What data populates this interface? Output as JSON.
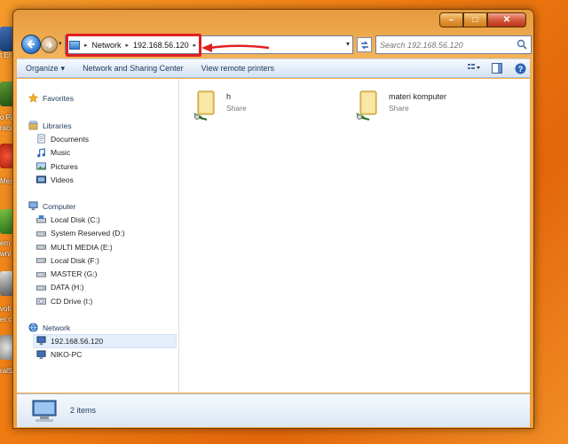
{
  "window": {
    "caption": {
      "minimize": "–",
      "maximize": "□",
      "close": "✕"
    }
  },
  "address": {
    "segments": [
      "Network",
      "192.168.56.120"
    ],
    "separator": "▸"
  },
  "search": {
    "placeholder": "Search 192.168.56.120"
  },
  "command_bar": {
    "organize": "Organize",
    "organize_arrow": "▾",
    "network_center": "Network and Sharing Center",
    "view_printers": "View remote printers"
  },
  "nav": {
    "favorites": "Favorites",
    "libraries": {
      "label": "Libraries",
      "items": [
        "Documents",
        "Music",
        "Pictures",
        "Videos"
      ]
    },
    "computer": {
      "label": "Computer",
      "drives": [
        "Local Disk (C:)",
        "System Reserved (D:)",
        "MULTI MEDIA (E:)",
        "Local Disk (F:)",
        "MASTER (G:)",
        "DATA (H:)",
        "CD Drive (I:)"
      ]
    },
    "network": {
      "label": "Network",
      "items": [
        "192.168.56.120",
        "NIKO-PC"
      ],
      "selected": "192.168.56.120"
    }
  },
  "files": [
    {
      "name": "h",
      "type": "Share"
    },
    {
      "name": "materi komputer",
      "type": "Share"
    }
  ],
  "details": {
    "count": "2 items"
  },
  "desktop": {
    "labels": [
      "t Er",
      "o Pa",
      "race",
      "Mesi",
      "ern",
      "wnl",
      "voli",
      "er c",
      "ralS"
    ]
  },
  "colors": {
    "accent_red": "#e02020",
    "desktop_orange": "#f07d12"
  },
  "icons": [
    "back-arrow-icon",
    "forward-arrow-icon",
    "network-icon",
    "refresh-icon",
    "search-icon",
    "star-icon",
    "library-icon",
    "computer-icon",
    "drive-icon",
    "folder-share-icon"
  ]
}
